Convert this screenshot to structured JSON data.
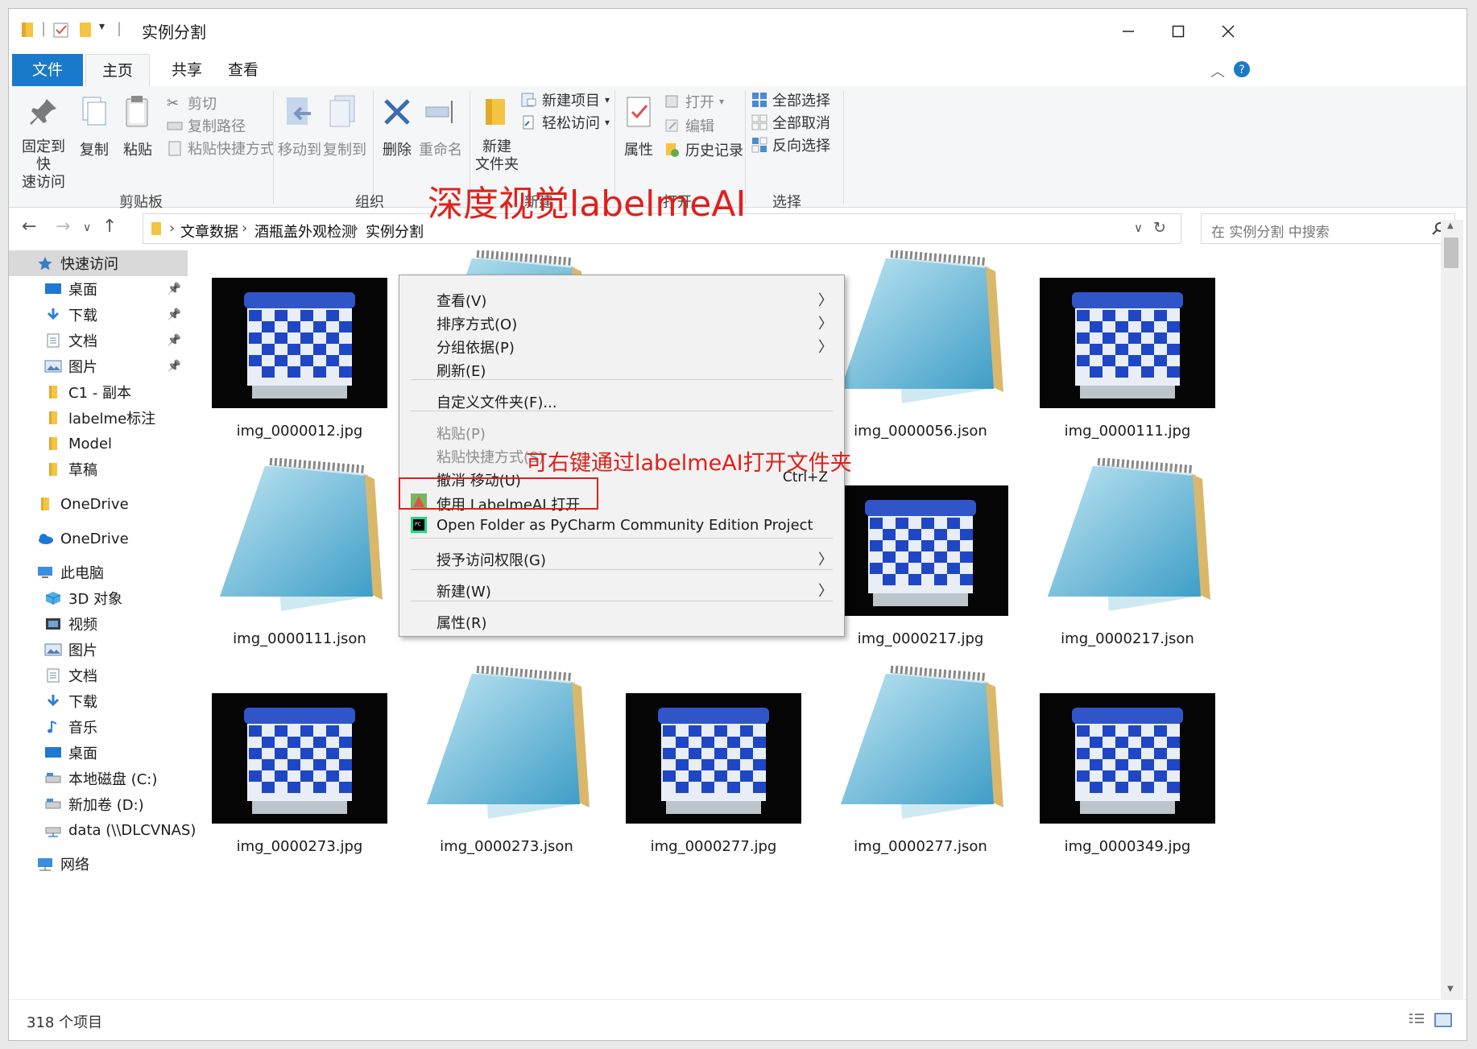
{
  "window": {
    "title": "实例分割"
  },
  "tabs": {
    "file": "文件",
    "home": "主页",
    "share": "共享",
    "view": "查看"
  },
  "ribbon": {
    "pin": "固定到快\n速访问",
    "copy": "复制",
    "paste": "粘贴",
    "cut": "剪切",
    "copy_path": "复制路径",
    "paste_shortcut": "粘贴快捷方式",
    "group_clipboard": "剪贴板",
    "move_to": "移动到",
    "copy_to": "复制到",
    "delete": "删除",
    "rename": "重命名",
    "group_organize": "组织",
    "new_folder": "新建\n文件夹",
    "new_item": "新建项目",
    "easy_access": "轻松访问",
    "group_new": "新建",
    "properties": "属性",
    "open": "打开",
    "edit": "编辑",
    "history": "历史记录",
    "group_open": "打开",
    "select_all": "全部选择",
    "select_none": "全部取消",
    "invert": "反向选择",
    "group_select": "选择"
  },
  "address": {
    "crumbs": [
      "文章数据",
      "酒瓶盖外观检测",
      "实例分割"
    ],
    "search_placeholder": "在 实例分割 中搜索"
  },
  "overlay_title": "深度视觉labelmeAI",
  "sidebar": {
    "items": [
      {
        "label": "快速访问",
        "icon": "star-icon",
        "pinned": false
      },
      {
        "label": "桌面",
        "icon": "desktop-icon",
        "pinned": true
      },
      {
        "label": "下载",
        "icon": "download-icon",
        "pinned": true
      },
      {
        "label": "文档",
        "icon": "document-icon",
        "pinned": true
      },
      {
        "label": "图片",
        "icon": "pictures-icon",
        "pinned": true
      },
      {
        "label": "C1 - 副本",
        "icon": "folder-icon",
        "pinned": false
      },
      {
        "label": "labelme标注",
        "icon": "folder-icon",
        "pinned": false
      },
      {
        "label": "Model",
        "icon": "folder-icon",
        "pinned": false
      },
      {
        "label": "草稿",
        "icon": "folder-icon",
        "pinned": false
      },
      {
        "label": "OneDrive",
        "icon": "folder-icon",
        "pinned": false
      },
      {
        "label": "OneDrive",
        "icon": "cloud-icon",
        "pinned": false
      },
      {
        "label": "此电脑",
        "icon": "computer-icon",
        "pinned": false
      },
      {
        "label": "3D 对象",
        "icon": "3d-objects-icon",
        "pinned": false
      },
      {
        "label": "视频",
        "icon": "video-icon",
        "pinned": false
      },
      {
        "label": "图片",
        "icon": "pictures-icon",
        "pinned": false
      },
      {
        "label": "文档",
        "icon": "document-icon",
        "pinned": false
      },
      {
        "label": "下载",
        "icon": "download-icon",
        "pinned": false
      },
      {
        "label": "音乐",
        "icon": "music-icon",
        "pinned": false
      },
      {
        "label": "桌面",
        "icon": "desktop-icon",
        "pinned": false
      },
      {
        "label": "本地磁盘 (C:)",
        "icon": "drive-icon",
        "pinned": false
      },
      {
        "label": "新加卷 (D:)",
        "icon": "drive-icon",
        "pinned": false
      },
      {
        "label": "data (\\\\DLCVNAS)",
        "icon": "network-drive-icon",
        "pinned": false
      },
      {
        "label": "网络",
        "icon": "network-icon",
        "pinned": false
      }
    ]
  },
  "files": [
    {
      "name": "img_0000012.jpg",
      "type": "jpg"
    },
    {
      "name": "",
      "type": "json"
    },
    {
      "name": "",
      "type": "jpg"
    },
    {
      "name": "img_0000056.json",
      "type": "json"
    },
    {
      "name": "img_0000111.jpg",
      "type": "jpg"
    },
    {
      "name": "img_0000111.json",
      "type": "json"
    },
    {
      "name": "",
      "type": "hidden"
    },
    {
      "name": "",
      "type": "hidden"
    },
    {
      "name": "img_0000217.jpg",
      "type": "jpg"
    },
    {
      "name": "img_0000217.json",
      "type": "json"
    },
    {
      "name": "img_0000273.jpg",
      "type": "jpg"
    },
    {
      "name": "img_0000273.json",
      "type": "json"
    },
    {
      "name": "img_0000277.jpg",
      "type": "jpg"
    },
    {
      "name": "img_0000277.json",
      "type": "json"
    },
    {
      "name": "img_0000349.jpg",
      "type": "jpg"
    }
  ],
  "context_menu": {
    "items": [
      {
        "label": "查看(V)",
        "submenu": true,
        "disabled": false
      },
      {
        "label": "排序方式(O)",
        "submenu": true,
        "disabled": false
      },
      {
        "label": "分组依据(P)",
        "submenu": true,
        "disabled": false
      },
      {
        "label": "刷新(E)",
        "submenu": false,
        "disabled": false
      },
      {
        "label": "自定义文件夹(F)...",
        "submenu": false,
        "disabled": false
      },
      {
        "label": "粘贴(P)",
        "submenu": false,
        "disabled": true
      },
      {
        "label": "粘贴快捷方式(S)",
        "submenu": false,
        "disabled": true
      },
      {
        "label": "撤消 移动(U)",
        "submenu": false,
        "disabled": false,
        "shortcut": "Ctrl+Z"
      },
      {
        "label": "使用 LabelmeAI 打开",
        "submenu": false,
        "disabled": false,
        "icon": "labelmeai-icon"
      },
      {
        "label": "Open Folder as PyCharm Community Edition Project",
        "submenu": false,
        "disabled": false,
        "icon": "pycharm-icon"
      },
      {
        "label": "授予访问权限(G)",
        "submenu": true,
        "disabled": false
      },
      {
        "label": "新建(W)",
        "submenu": true,
        "disabled": false
      },
      {
        "label": "属性(R)",
        "submenu": false,
        "disabled": false
      }
    ],
    "annotation": "可右键通过labelmeAI打开文件夹"
  },
  "status": {
    "item_count": "318 个项目"
  },
  "colors": {
    "accent": "#1979ca",
    "annotation_red": "#e0201b",
    "folder_yellow": "#f4c542"
  }
}
